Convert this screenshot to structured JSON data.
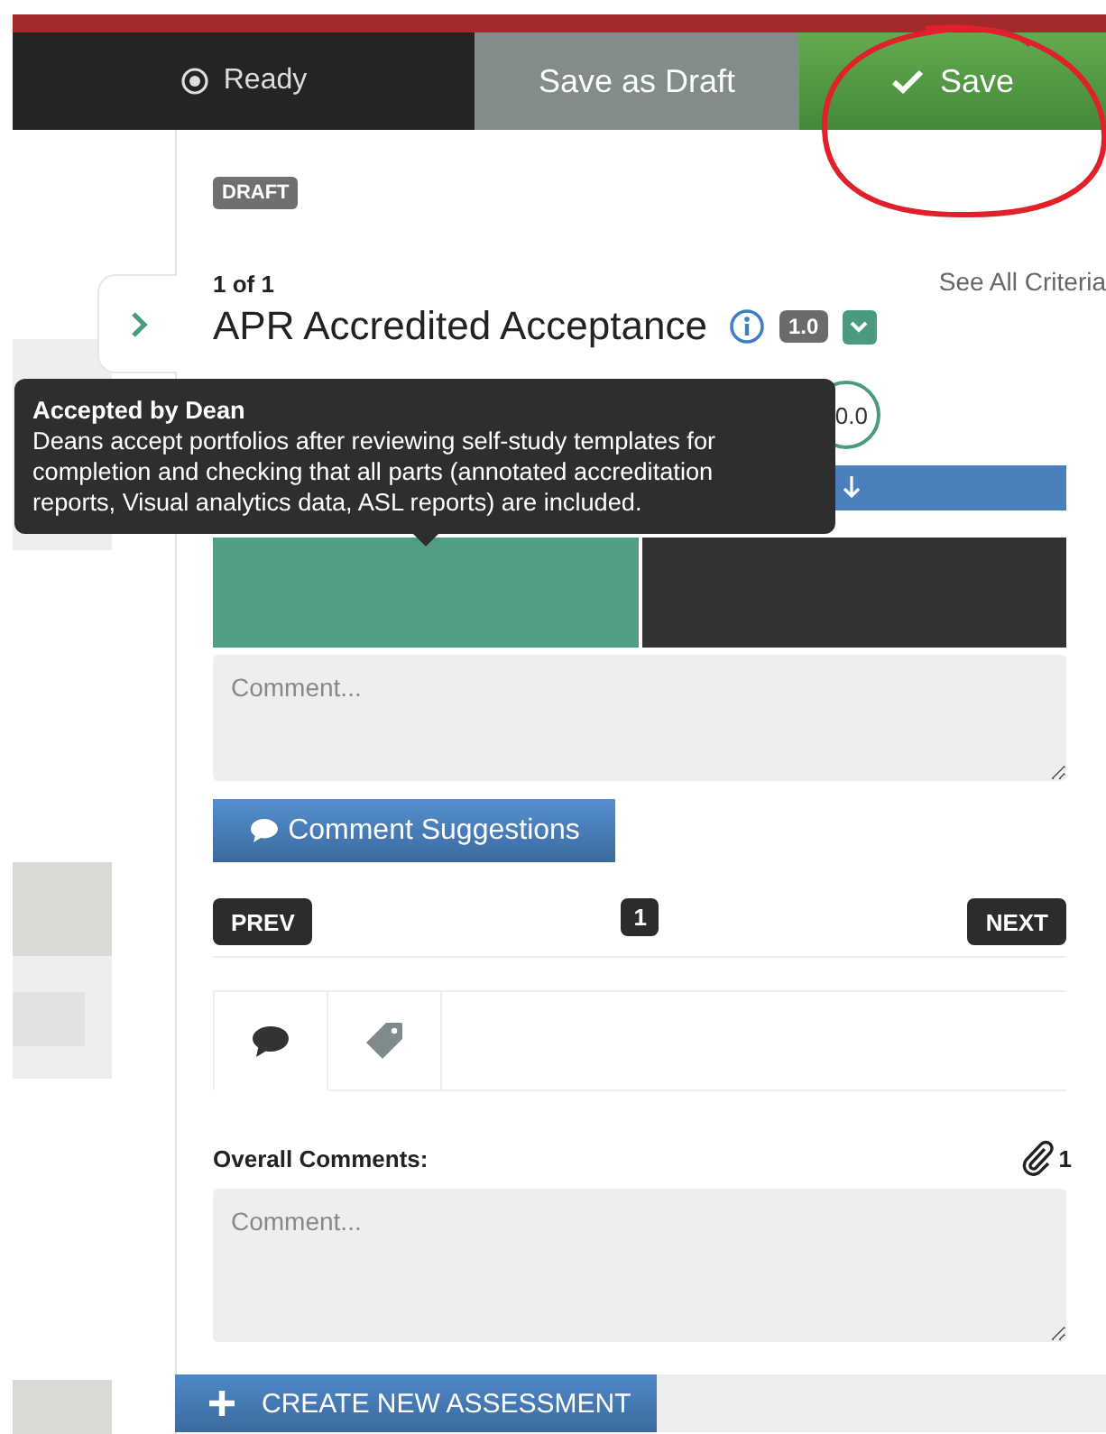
{
  "status": {
    "label": "Ready"
  },
  "actions": [
    {
      "kind": "draft",
      "label": "Save as Draft"
    },
    {
      "kind": "save",
      "label": "Save"
    }
  ],
  "annotation": {
    "kind": "circle"
  },
  "badge": "DRAFT",
  "criteria": {
    "position": "1 of 1",
    "see_all": "See All Criteria",
    "title": "APR Accredited Acceptance",
    "weight": "1.0",
    "score": "0.0"
  },
  "tooltip": {
    "title": "Accepted by Dean",
    "text": "Deans accept portfolios after reviewing self-study templates for completion and checking that all parts (annotated accreditation reports, Visual analytics data, ASL reports) are included."
  },
  "rating_options": [
    {
      "selected": true
    },
    {
      "selected": false
    }
  ],
  "comment": {
    "placeholder": "Comment..."
  },
  "suggestions_button": "Comment Suggestions",
  "pager": {
    "prev": "PREV",
    "page": "1",
    "next": "NEXT"
  },
  "tabs": [
    {
      "kind": "comment",
      "selected": true
    },
    {
      "kind": "tag",
      "selected": false
    }
  ],
  "overall": {
    "label": "Overall Comments:",
    "attachments": "1",
    "placeholder": "Comment..."
  },
  "create_button": "CREATE NEW ASSESSMENT"
}
